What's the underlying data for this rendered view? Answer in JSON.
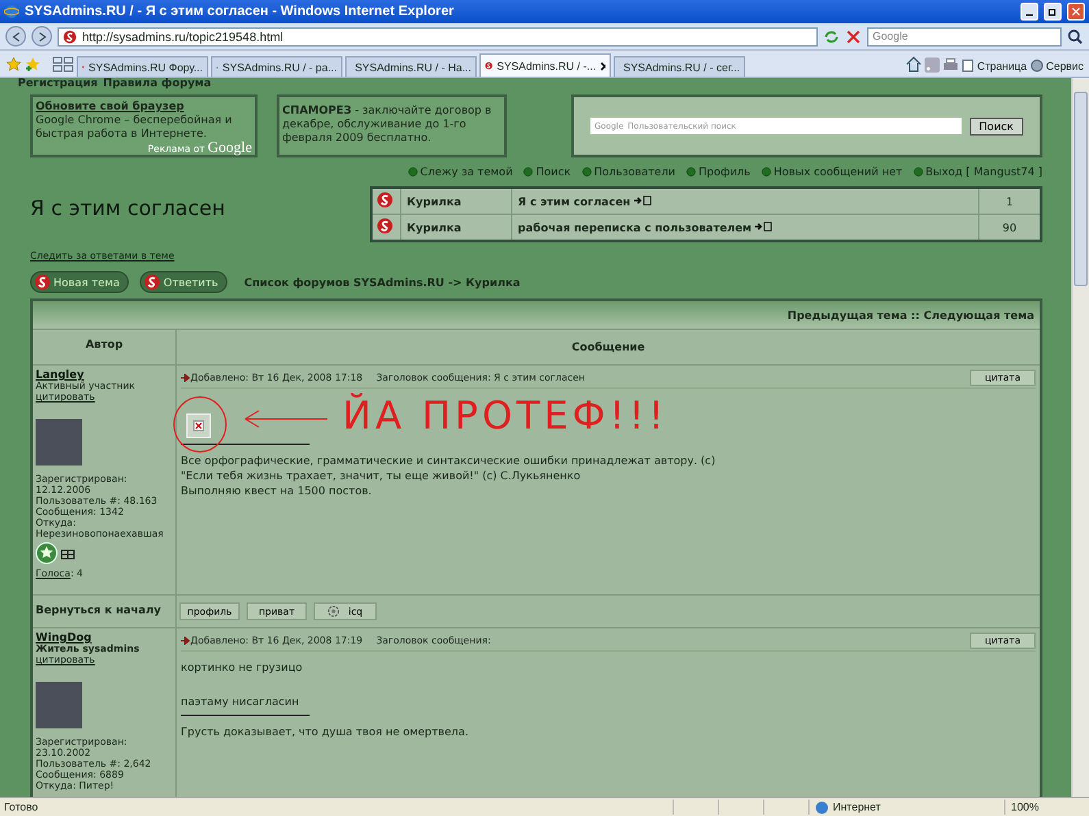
{
  "window": {
    "title": "SYSAdmins.RU / - Я с этим согласен - Windows Internet Explorer"
  },
  "address_bar": {
    "url": "http://sysadmins.ru/topic219548.html",
    "search_placeholder": "Google"
  },
  "tabs": [
    {
      "label": "SYSAdmins.RU Фору...",
      "kind": "site",
      "selected": false
    },
    {
      "label": "SYSAdmins.RU / - ра...",
      "kind": "ie",
      "selected": false
    },
    {
      "label": "SYSAdmins.RU / - На...",
      "kind": "site",
      "selected": false
    },
    {
      "label": "SYSAdmins.RU / -...",
      "kind": "site",
      "selected": true
    },
    {
      "label": "SYSAdmins.RU / - сег...",
      "kind": "site",
      "selected": false
    }
  ],
  "toolbar": {
    "page_menu": "Страница",
    "tools_menu": "Сервис"
  },
  "top_links": [
    "Регистрация",
    "Правила форума"
  ],
  "ads": [
    {
      "title": "Обновите свой браузер",
      "text": "Google Chrome – бесперебойная и быстрая работа в Интернете.",
      "footer": "Реклама от",
      "brand": "Google"
    },
    {
      "title": "СПАМОРЕЗ",
      "text": " - заключайте договор в декабре, обслуживание до 1-го февраля 2009 бесплатно."
    }
  ],
  "site_search": {
    "placeholder": "Пользовательский поиск",
    "brand": "Google",
    "button": "Поиск"
  },
  "nav_links": [
    {
      "label": "Слежу за темой"
    },
    {
      "label": "Поиск"
    },
    {
      "label": "Пользователи"
    },
    {
      "label": "Профиль"
    },
    {
      "label": "Новых сообщений нет"
    },
    {
      "label": "Выход [ Mangust74 ]"
    }
  ],
  "topic_title": "Я с этим согласен",
  "related_topics": [
    {
      "forum": "Курилка",
      "title": "Я с этим согласен",
      "count": "1"
    },
    {
      "forum": "Курилка",
      "title": "рабочая переписка с пользователем",
      "count": "90"
    }
  ],
  "watch_link": "Следить за ответами в теме",
  "actions": [
    "Новая тема",
    "Ответить"
  ],
  "breadcrumb": "Список форумов SYSAdmins.RU -> Курилка",
  "posts_table": {
    "nav": "Предыдущая тема :: Следующая тема",
    "columns": [
      "Автор",
      "Сообщение"
    ],
    "posts": [
      {
        "author": "Langley",
        "rank": "Активный участник",
        "rank_bold": false,
        "quote_link": "цитировать",
        "info": [
          "Зарегистрирован:",
          "12.12.2006",
          "Пользователь #: 48.163",
          "Сообщения: 1342",
          "Откуда:",
          "Нерезиновопонаехавшая"
        ],
        "votes_label": "Голоса",
        "votes_value": ": 4",
        "meta": "Добавлено: Вт 16 Дек, 2008 17:18",
        "subject": "Заголовок сообщения: Я с этим согласен",
        "quote_button": "цитата",
        "annotation": "ЙА ПРОТЕФ!!!",
        "body": [
          {
            "kind": "image"
          },
          {
            "kind": "separator"
          },
          {
            "kind": "text",
            "text": "Все орфографические, грамматические и синтаксические ошибки принадлежат автору. (с)"
          },
          {
            "kind": "text",
            "text": "\"Если тебя жизнь трахает, значит, ты еще живой!\" (с) С.Лукьяненко"
          },
          {
            "kind": "text",
            "text": "Выполняю квест на 1500 постов."
          }
        ],
        "back_to_top": "Вернуться к началу",
        "buttons": [
          "профиль",
          "приват",
          "icq"
        ]
      },
      {
        "author": "WingDog",
        "rank": "Житель sysadmins",
        "rank_bold": true,
        "quote_link": "цитировать",
        "info": [
          "Зарегистрирован:",
          "23.10.2002",
          "Пользователь #: 2,642",
          "Сообщения: 6889",
          "Откуда: Питер!"
        ],
        "meta": "Добавлено: Вт 16 Дек, 2008 17:19",
        "subject": "Заголовок сообщения:",
        "quote_button": "цитата",
        "body": [
          {
            "kind": "text",
            "text": "кортинко не грузицо"
          },
          {
            "kind": "gap"
          },
          {
            "kind": "text",
            "text": "паэтаму нисагласин"
          },
          {
            "kind": "separator"
          },
          {
            "kind": "text",
            "text": "Грусть доказывает, что душа твоя не омертвела."
          }
        ]
      }
    ]
  },
  "status_bar": {
    "text": "Готово",
    "zone": "Интернет",
    "zoom": "100%"
  }
}
